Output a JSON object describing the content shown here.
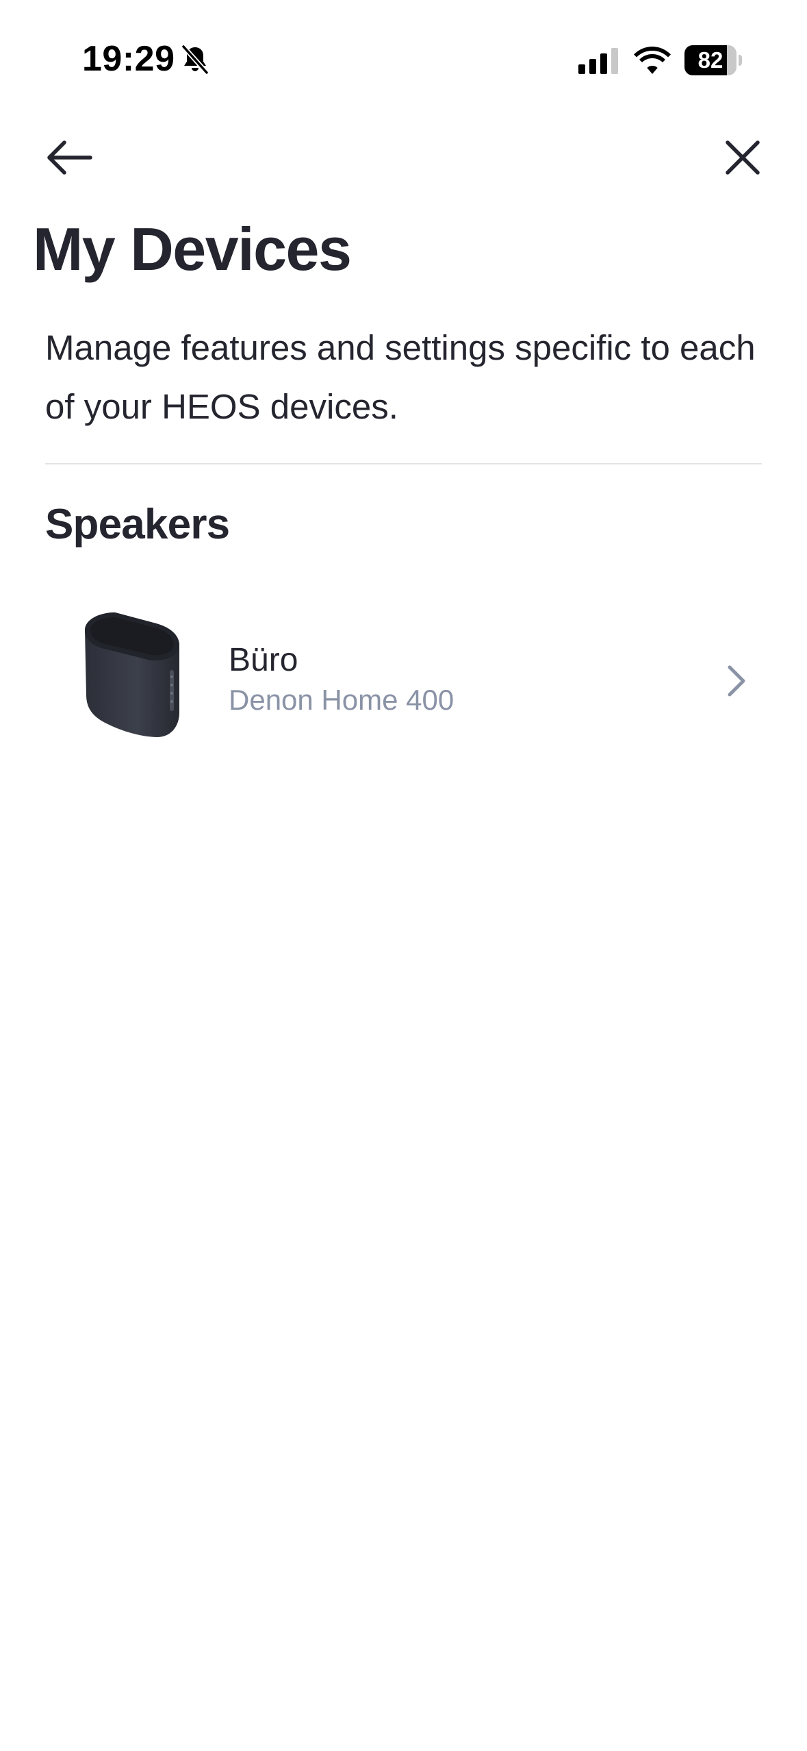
{
  "status_bar": {
    "time": "19:29",
    "battery_level": 82,
    "battery_label": "82",
    "icons": [
      "bell-slash-icon",
      "cellular-signal-icon",
      "wifi-icon",
      "battery-icon"
    ]
  },
  "nav": {
    "back_icon": "arrow-left-icon",
    "close_icon": "close-icon"
  },
  "header": {
    "title": "My Devices",
    "description": "Manage features and settings specific to each of your HEOS devices."
  },
  "sections": [
    {
      "title": "Speakers",
      "devices": [
        {
          "name": "Büro",
          "model": "Denon Home 400",
          "icon": "speaker-image"
        }
      ]
    }
  ],
  "colors": {
    "text_primary": "#25252f",
    "text_secondary": "#8a93a6",
    "divider": "#e3e3e6",
    "background": "#ffffff"
  }
}
